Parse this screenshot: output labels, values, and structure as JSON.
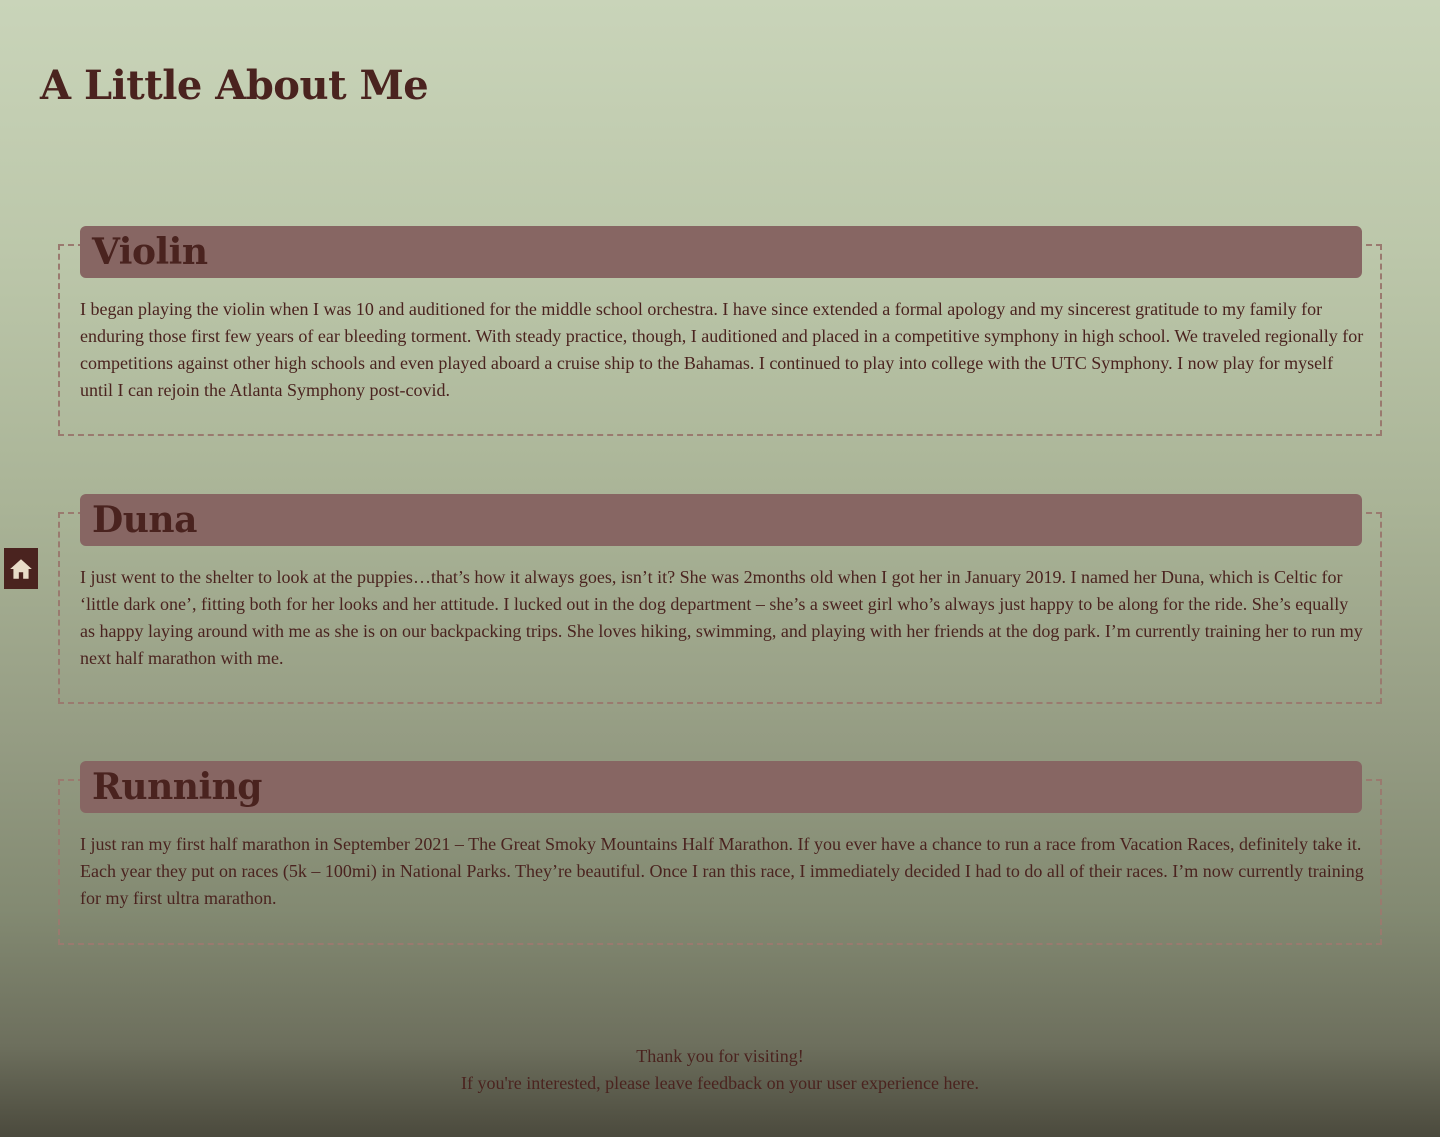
{
  "page": {
    "title": "A Little About Me"
  },
  "nav": {
    "home_icon": "home-icon"
  },
  "sections": [
    {
      "heading": "Violin",
      "body": "I began playing the violin when I was 10 and auditioned for the middle school orchestra. I have since extended a formal apology and my sincerest gratitude to my family for enduring those first few years of ear bleeding torment. With steady practice, though, I auditioned and placed in a competitive symphony in high school. We traveled regionally for competitions against other high schools and even played aboard a cruise ship to the Bahamas. I continued to play into college with the UTC Symphony. I now play for myself until I can rejoin the Atlanta Symphony post-covid."
    },
    {
      "heading": "Duna",
      "body": "I just went to the shelter to look at the puppies…that’s how it always goes, isn’t it? She was 2months old when I got her in January 2019. I named her Duna, which is Celtic for ‘little dark one’, fitting both for her looks and her attitude. I lucked out in the dog department – she’s a sweet girl who’s always just happy to be along for the ride. She’s equally as happy laying around with me as she is on our backpacking trips. She loves hiking, swimming, and playing with her friends at the dog park. I’m currently training her to run my next half marathon with me."
    },
    {
      "heading": "Running",
      "body": "I just ran my first half marathon in September 2021 – The Great Smoky Mountains Half Marathon. If you ever have a chance to run a race from Vacation Races, definitely take it. Each year they put on races (5k – 100mi) in National Parks. They’re beautiful. Once I ran this race, I immediately decided I had to do all of their races. I’m now currently training for my first ultra marathon."
    }
  ],
  "footer": {
    "line1": "Thank you for visiting!",
    "line2": "If you're interested, please leave feedback on your user experience here."
  },
  "colors": {
    "text": "#4a231f",
    "header_band": "#876663",
    "dashed_border": "#9a7a6f",
    "home_icon_fill": "#e8dcc8"
  }
}
